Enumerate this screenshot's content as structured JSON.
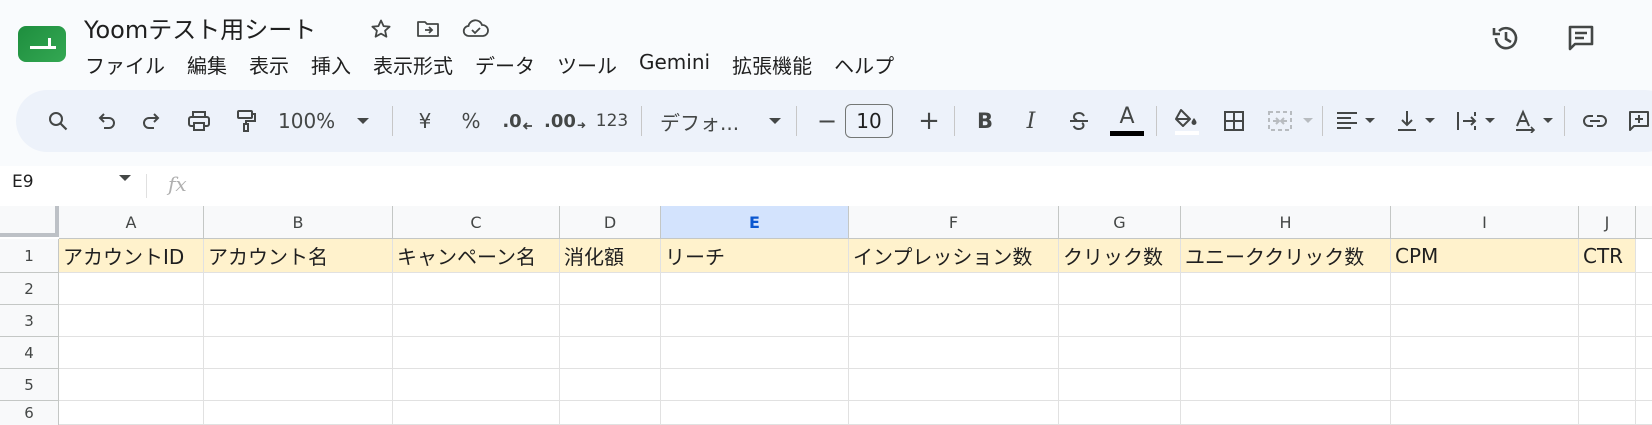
{
  "app": {
    "doc_title": "Yoomテスト用シート",
    "icons": {
      "logo": "sheets-logo-icon",
      "star": "star-icon",
      "move": "folder-move-icon",
      "cloud": "cloud-status-icon",
      "history": "history-icon",
      "comments": "comment-icon"
    },
    "brand_color": "#0f9d58"
  },
  "menu": {
    "items": [
      {
        "label": "ファイル"
      },
      {
        "label": "編集"
      },
      {
        "label": "表示"
      },
      {
        "label": "挿入"
      },
      {
        "label": "表示形式"
      },
      {
        "label": "データ"
      },
      {
        "label": "ツール"
      },
      {
        "label": "Gemini"
      },
      {
        "label": "拡張機能"
      },
      {
        "label": "ヘルプ"
      }
    ]
  },
  "toolbar": {
    "zoom": "100%",
    "currency": "¥",
    "percent": "%",
    "decrease_decimal": ".0",
    "increase_decimal": ".00",
    "number_format": "123",
    "font": "デフォ...",
    "minus": "−",
    "font_size": "10",
    "plus": "+",
    "bold": "B",
    "italic": "I",
    "text_color_letter": "A",
    "text_color": "#000000"
  },
  "formula_bar": {
    "name_box": "E9",
    "fx": "fx",
    "value": ""
  },
  "sheet": {
    "columns": [
      "A",
      "B",
      "C",
      "D",
      "E",
      "F",
      "G",
      "H",
      "I",
      "J"
    ],
    "selected_column": "E",
    "rows": [
      "1",
      "2",
      "3",
      "4",
      "5",
      "6"
    ],
    "header_row": [
      "アカウントID",
      "アカウント名",
      "キャンペーン名",
      "消化額",
      "リーチ",
      "インプレッション数",
      "クリック数",
      "ユニーククリック数",
      "CPM",
      "CTR"
    ],
    "header_fill": "#fff2cc"
  }
}
